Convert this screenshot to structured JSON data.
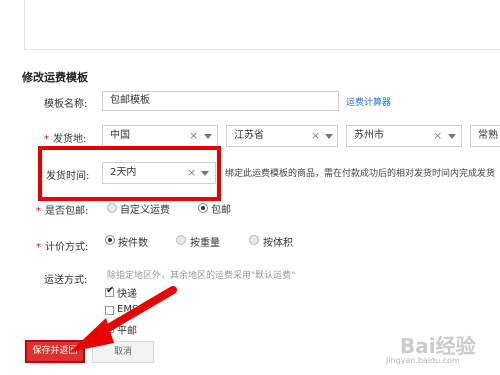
{
  "section_title": "修改运费模板",
  "template_name": {
    "label": "模板名称:",
    "value": "包邮模板",
    "calc_link": "运费计算器"
  },
  "ship_from": {
    "label": "发货地:",
    "country": "中国",
    "province": "江苏省",
    "city": "苏州市",
    "district": "常熟"
  },
  "ship_time": {
    "label": "发货时间:",
    "value": "2天内",
    "description": "绑定此运费模板的商品，需在付款成功后的相对发货时间内完成发货"
  },
  "free_shipping": {
    "label": "是否包邮:",
    "options": [
      "自定义运费",
      "包邮"
    ],
    "selected": "包邮"
  },
  "pricing": {
    "label": "计价方式:",
    "options": [
      "按件数",
      "按重量",
      "按体积"
    ],
    "selected": "按件数"
  },
  "delivery": {
    "label": "运送方式:",
    "hint": "除指定地区外，其余地区的运费采用\"默认运费\"",
    "options": [
      {
        "label": "快递",
        "checked": true
      },
      {
        "label": "EMS",
        "checked": false
      },
      {
        "label": "平邮",
        "checked": false
      }
    ]
  },
  "buttons": {
    "save": "保存并返回",
    "cancel": "取消"
  },
  "watermark": {
    "text": "Bai经验",
    "url": "jingyan.baidu.com"
  },
  "colors": {
    "accent_red": "#e60000",
    "link_blue": "#1e73d8"
  }
}
